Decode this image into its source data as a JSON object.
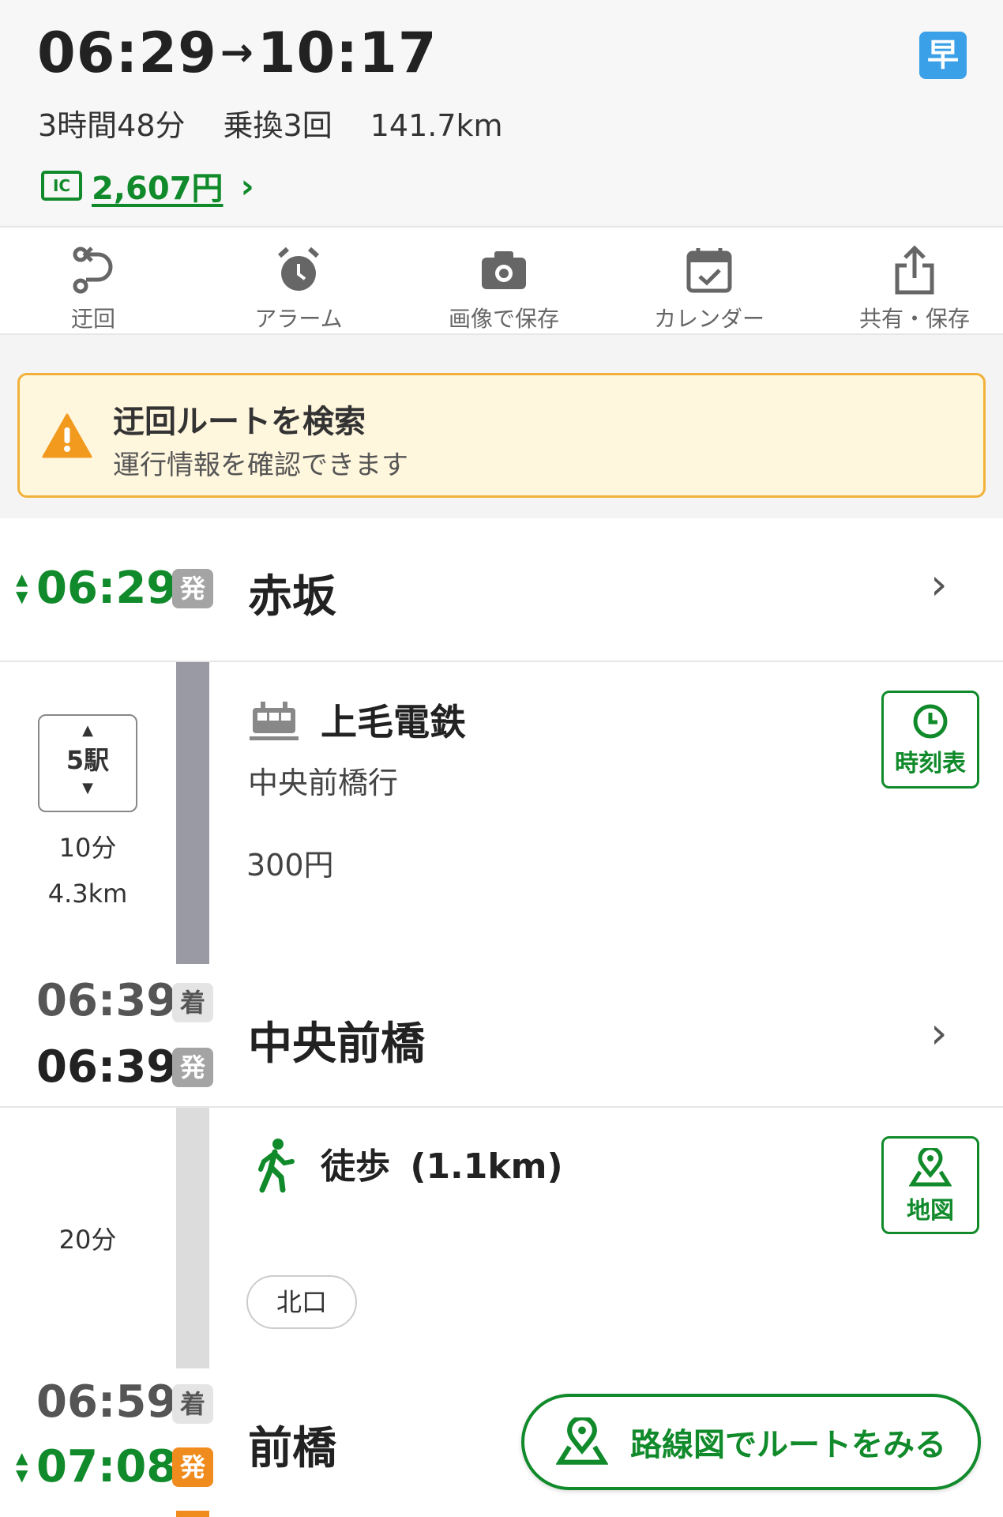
{
  "summary": {
    "depart": "06:29",
    "arrow": "→",
    "arrive": "10:17",
    "badge": "早",
    "duration": "3時間48分",
    "transfers": "乗換3回",
    "distance": "141.7km",
    "ic_label": "IC",
    "fare": "2,607円"
  },
  "toolbar": [
    {
      "label": "迂回",
      "icon": "detour-icon"
    },
    {
      "label": "アラーム",
      "icon": "alarm-clock-icon"
    },
    {
      "label": "画像で保存",
      "icon": "camera-icon"
    },
    {
      "label": "カレンダー",
      "icon": "calendar-check-icon"
    },
    {
      "label": "共有・保存",
      "icon": "share-icon"
    }
  ],
  "alert": {
    "title": "迂回ルートを検索",
    "subtitle": "運行情報を確認できます"
  },
  "route": {
    "start": {
      "time": "06:29",
      "tag": "発",
      "name": "赤坂"
    },
    "train_segment": {
      "stations": "5駅",
      "duration": "10分",
      "distance": "4.3km",
      "line": "上毛電鉄",
      "direction": "中央前橋行",
      "fare": "300円",
      "timetable_label": "時刻表"
    },
    "transfer1": {
      "arr_time": "06:39",
      "arr_tag": "着",
      "dep_time": "06:39",
      "dep_tag": "発",
      "name": "中央前橋"
    },
    "walk_segment": {
      "duration": "20分",
      "label": "徒歩",
      "distance": "(1.1km)",
      "map_label": "地図",
      "exit": "北口"
    },
    "transfer2": {
      "arr_time": "06:59",
      "arr_tag": "着",
      "dep_time": "07:08",
      "dep_tag": "発",
      "name": "前橋"
    }
  },
  "route_map_button": "路線図でルートをみる",
  "colors": {
    "accent_green": "#108a2a",
    "badge_blue": "#3aa0e8",
    "alert_bg": "#fff6de",
    "alert_border": "#f2b13a",
    "departure_orange": "#f08c1e"
  }
}
